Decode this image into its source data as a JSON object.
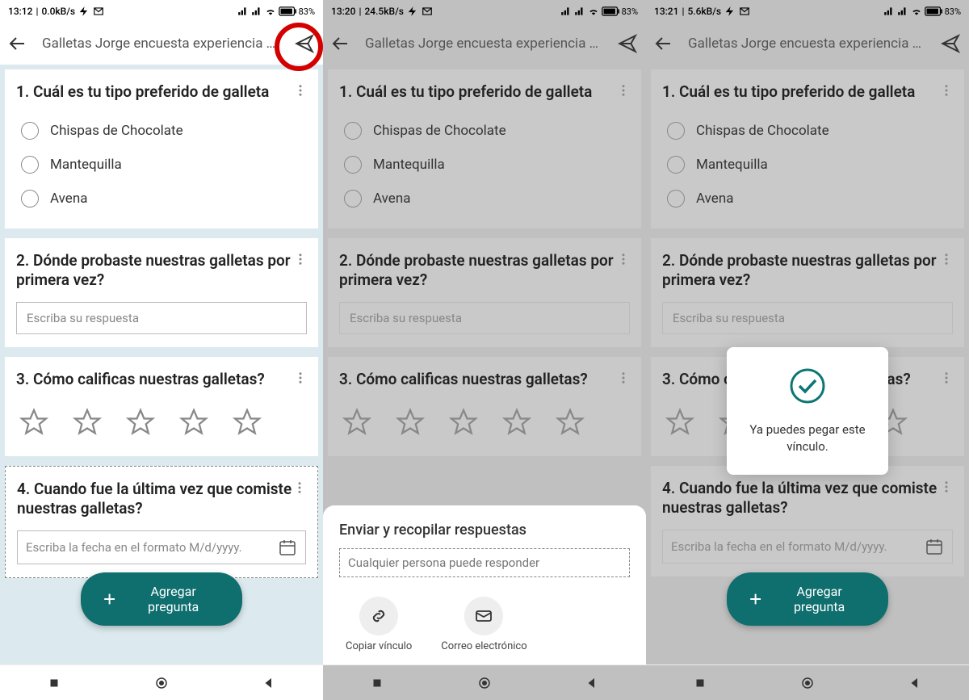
{
  "screens": [
    {
      "time": "13:12",
      "speed": "0.0kB/s",
      "battery": "83%"
    },
    {
      "time": "13:20",
      "speed": "24.5kB/s",
      "battery": "83%"
    },
    {
      "time": "13:21",
      "speed": "5.6kB/s",
      "battery": "83%"
    }
  ],
  "appbar": {
    "title": "Galletas Jorge encuesta experiencia u..."
  },
  "q1": {
    "title": "1. Cuál es tu tipo preferido de galleta",
    "opt1": "Chispas de Chocolate",
    "opt2": "Mantequilla",
    "opt3": "Avena"
  },
  "q2": {
    "title": "2. Dónde probaste nuestras galletas por primera vez?",
    "placeholder": "Escriba su respuesta"
  },
  "q3": {
    "title": "3. Cómo calificas nuestras galletas?"
  },
  "q4": {
    "title": "4. Cuando fue la última vez que comiste nuestras galletas?",
    "placeholder": "Escriba la fecha en el formato M/d/yyyy."
  },
  "addBtn": "Agregar pregunta",
  "sheet": {
    "title": "Enviar y recopilar respuestas",
    "field": "Cualquier persona puede responder",
    "action1": "Copiar vínculo",
    "action2": "Correo electrónico"
  },
  "toast": {
    "text": "Ya puedes pegar este vínculo."
  }
}
